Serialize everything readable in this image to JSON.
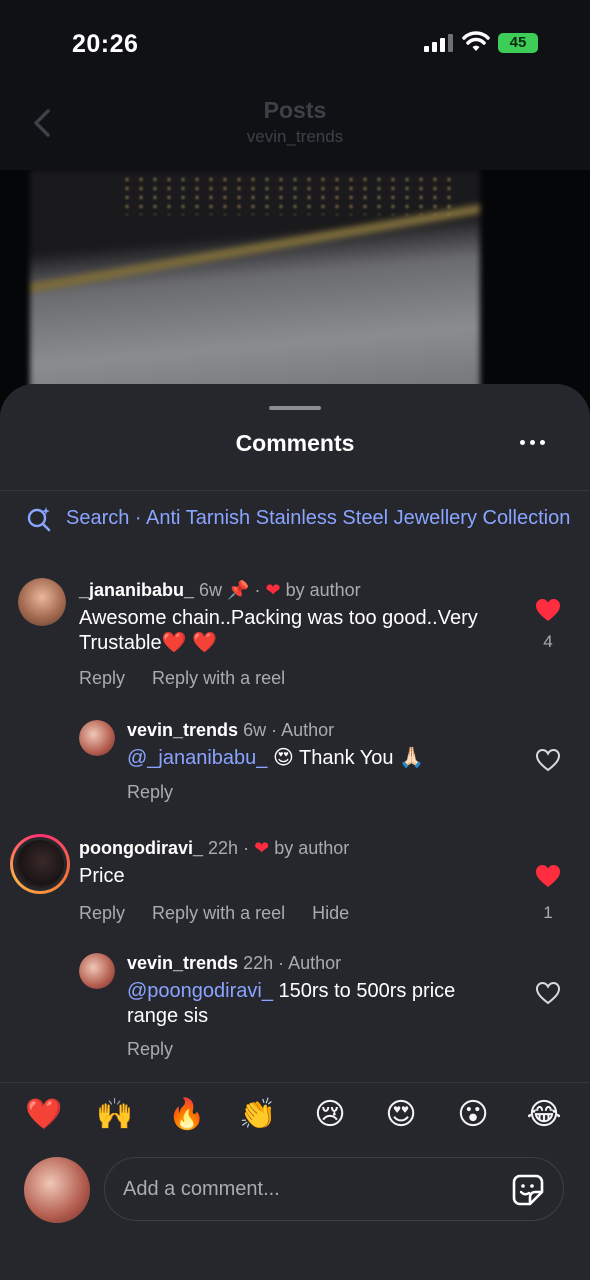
{
  "status": {
    "time": "20:26",
    "battery": "45"
  },
  "header": {
    "title": "Posts",
    "username": "vevin_trends"
  },
  "sheet": {
    "title": "Comments",
    "search": "Search · Anti Tarnish Stainless Steel Jewellery Collection"
  },
  "comments": [
    {
      "username": "_jananibabu_",
      "meta": "6w",
      "meta_tail": "by author",
      "text": "Awesome chain..Packing was too good..Very Trustable❤️ ❤️",
      "reply": "Reply",
      "reply_reel": "Reply with a reel",
      "likes": "4",
      "replies": [
        {
          "username": "vevin_trends",
          "meta": "6w · Author",
          "mention": "@_jananibabu_",
          "text": " 😍 Thank You 🙏🏻",
          "reply": "Reply"
        }
      ]
    },
    {
      "username": "poongodiravi_",
      "meta": "22h ·",
      "meta_tail": "by author",
      "text": "Price",
      "reply": "Reply",
      "reply_reel": "Reply with a reel",
      "hide": "Hide",
      "likes": "1",
      "replies": [
        {
          "username": "vevin_trends",
          "meta": "22h · Author",
          "mention": "@poongodiravi_",
          "text": " 150rs to 500rs price range sis",
          "reply": "Reply"
        }
      ]
    }
  ],
  "emoji_bar": [
    "❤️",
    "🙌",
    "🔥",
    "👏",
    "😢",
    "😍",
    "😮",
    "😂"
  ],
  "composer": {
    "placeholder": "Add a comment..."
  }
}
